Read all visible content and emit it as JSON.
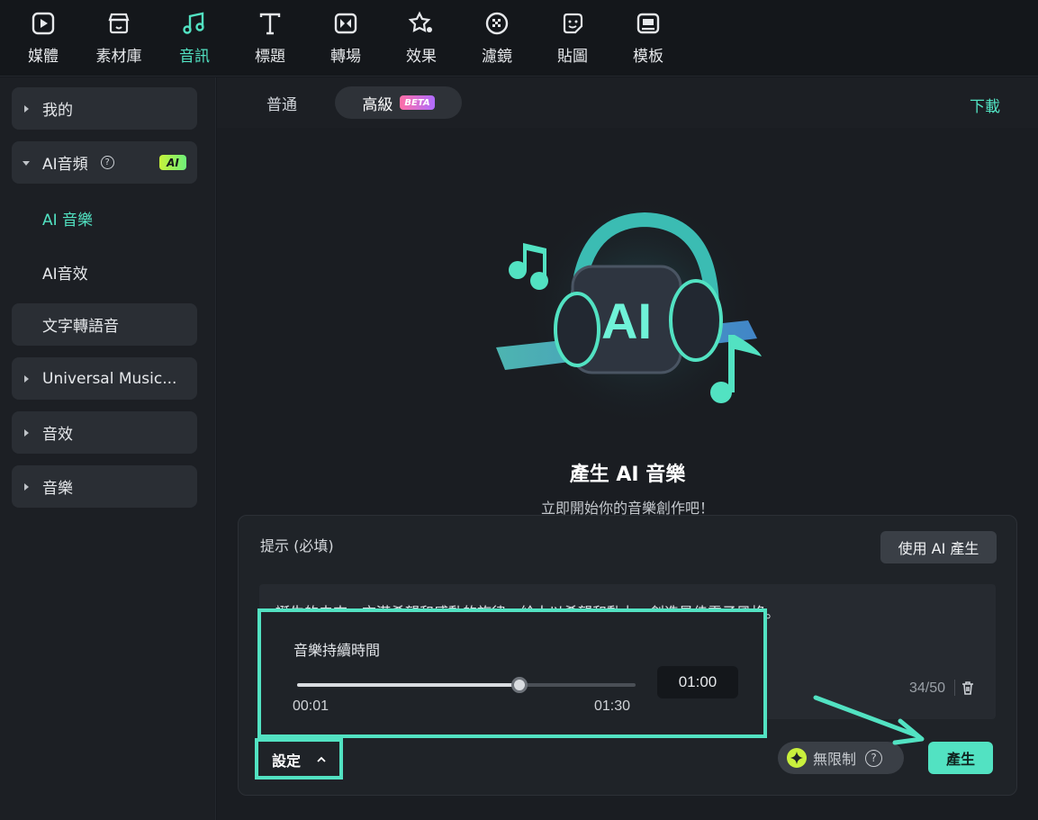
{
  "toolbar": {
    "items": [
      {
        "label": "媒體",
        "icon": "media-icon"
      },
      {
        "label": "素材庫",
        "icon": "stock-store-icon"
      },
      {
        "label": "音訊",
        "icon": "music-note-icon"
      },
      {
        "label": "標題",
        "icon": "title-t-icon"
      },
      {
        "label": "轉場",
        "icon": "transition-icon"
      },
      {
        "label": "效果",
        "icon": "effects-star-icon"
      },
      {
        "label": "濾鏡",
        "icon": "filter-icon"
      },
      {
        "label": "貼圖",
        "icon": "sticker-icon"
      },
      {
        "label": "模板",
        "icon": "template-icon"
      }
    ],
    "active": "音訊"
  },
  "sidebar": {
    "my": "我的",
    "ai_audio": "AI音頻",
    "ai_badge": "AI",
    "ai_music": "AI 音樂",
    "ai_sfx": "AI音效",
    "tts": "文字轉語音",
    "universal_music": "Universal Music...",
    "sound_effects": "音效",
    "music": "音樂"
  },
  "tabs": {
    "normal": "普通",
    "advanced": "高級",
    "beta": "BETA",
    "download": "下載"
  },
  "hero": {
    "title": "產生 AI 音樂",
    "subtitle": "立即開始你的音樂創作吧！",
    "graphic_text": "AI"
  },
  "prompt": {
    "label": "提示 (必填)",
    "use_ai_button": "使用 AI 產生",
    "text": "誕生的未來，充滿希望和感動的旋律，給人以希望和動力，創造最佳電子風格。",
    "counter": "34/50"
  },
  "settings": {
    "label": "設定",
    "duration_title": "音樂持續時間",
    "min": "00:01",
    "max": "01:30",
    "value": "01:00",
    "slider_fraction": 0.656
  },
  "footer": {
    "unlimited": "無限制",
    "generate": "產生"
  },
  "colors": {
    "accent": "#52e2c2",
    "background": "#1a1d22"
  }
}
